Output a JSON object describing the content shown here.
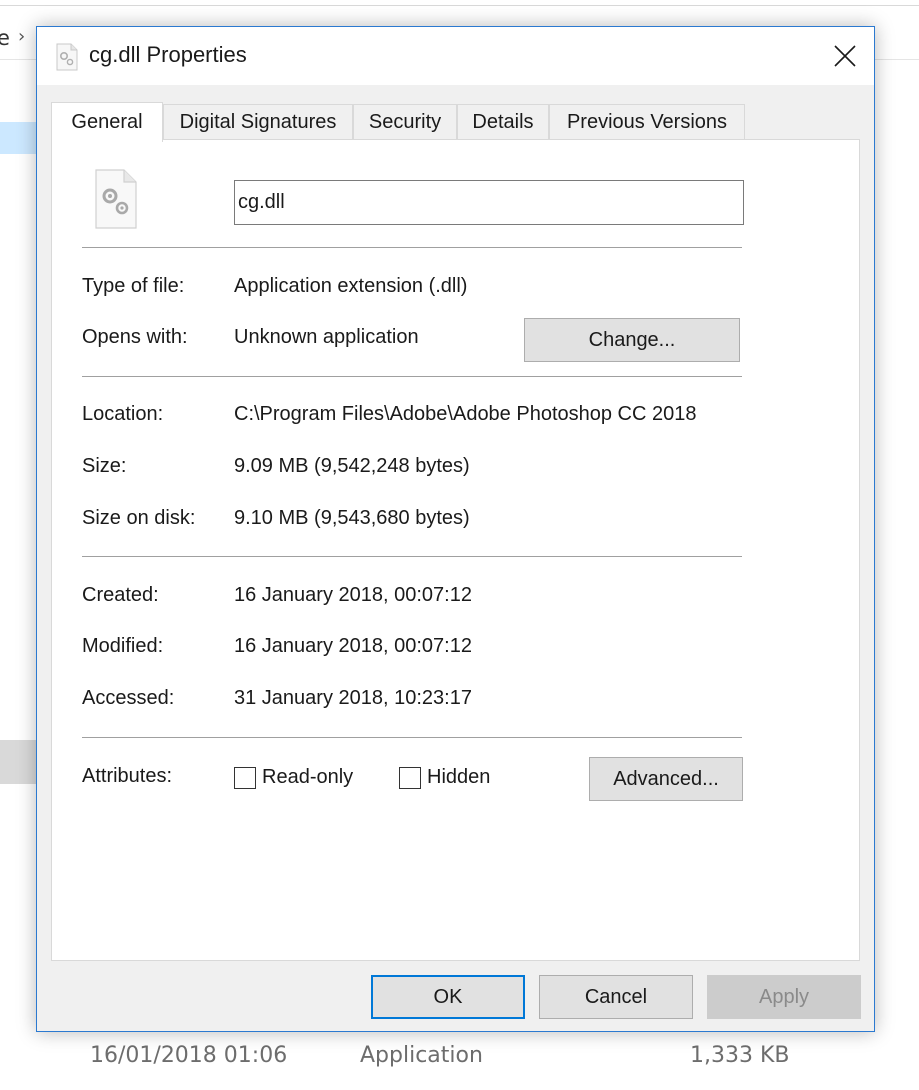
{
  "background": {
    "breadcrumb_text": "e",
    "chevron": "›",
    "row": {
      "date": "16/01/2018 01:06",
      "type": "Application",
      "size": "1,333 KB"
    }
  },
  "dialog": {
    "title": "cg.dll Properties",
    "title_icon": "dll-file-icon",
    "close_label": "✕",
    "tabs": [
      {
        "label": "General",
        "active": true
      },
      {
        "label": "Digital Signatures",
        "active": false
      },
      {
        "label": "Security",
        "active": false
      },
      {
        "label": "Details",
        "active": false
      },
      {
        "label": "Previous Versions",
        "active": false
      }
    ],
    "general": {
      "filename": "cg.dll",
      "type_label": "Type of file:",
      "type_value": "Application extension (.dll)",
      "opens_label": "Opens with:",
      "opens_value": "Unknown application",
      "change_button": "Change...",
      "location_label": "Location:",
      "location_value": "C:\\Program Files\\Adobe\\Adobe Photoshop CC 2018",
      "size_label": "Size:",
      "size_value": "9.09 MB (9,542,248 bytes)",
      "disk_label": "Size on disk:",
      "disk_value": "9.10 MB (9,543,680 bytes)",
      "created_label": "Created:",
      "created_value": "16 January 2018, 00:07:12",
      "modified_label": "Modified:",
      "modified_value": "16 January 2018, 00:07:12",
      "accessed_label": "Accessed:",
      "accessed_value": "31 January 2018, 10:23:17",
      "attributes_label": "Attributes:",
      "readonly_label": "Read-only",
      "readonly_checked": false,
      "hidden_label": "Hidden",
      "hidden_checked": false,
      "advanced_button": "Advanced..."
    },
    "footer": {
      "ok": "OK",
      "cancel": "Cancel",
      "apply": "Apply"
    }
  }
}
